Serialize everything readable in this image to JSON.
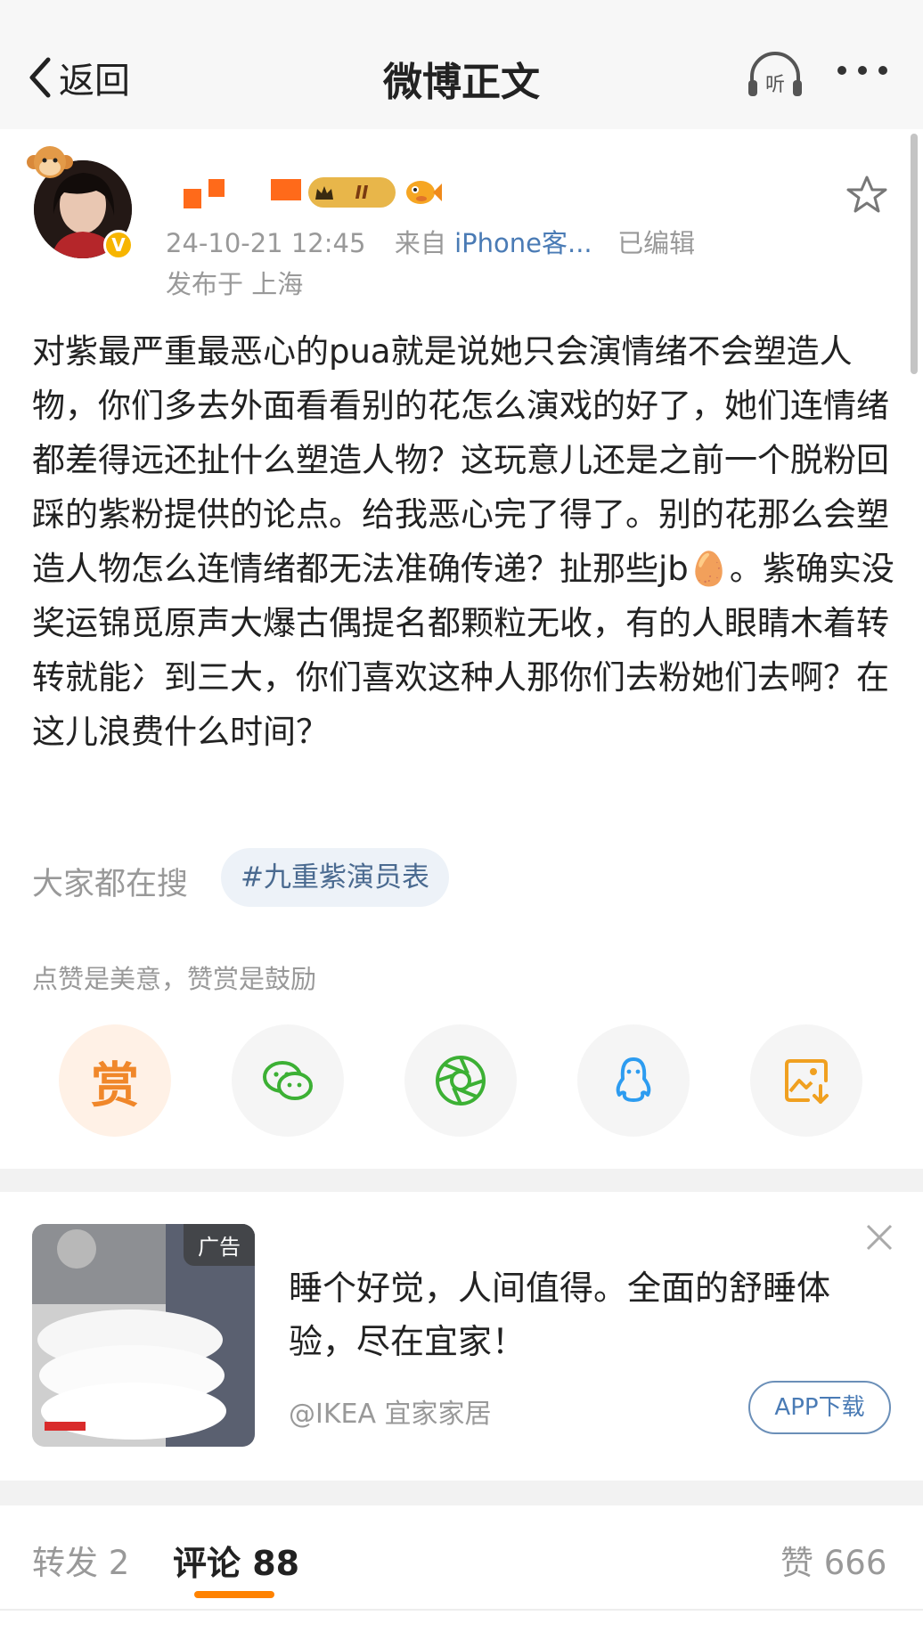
{
  "nav": {
    "back_label": "返回",
    "title": "微博正文",
    "listen_label": "听"
  },
  "author": {
    "verified_mark": "V",
    "level_badge": "II",
    "time": "24-10-21 12:45",
    "source_prefix": "来自",
    "source": "iPhone客...",
    "edited": "已编辑",
    "location": "发布于 上海"
  },
  "post": {
    "text": "对紫最严重最恶心的pua就是说她只会演情绪不会塑造人物，你们多去外面看看别的花怎么演戏的好了，她们连情绪都差得远还扯什么塑造人物？这玩意儿还是之前一个脱粉回踩的紫粉提供的论点。给我恶心完了得了。别的花那么会塑造人物怎么连情绪都无法准确传递？扯那些jb🥚。紫确实没奖运锦觅原声大爆古偶提名都颗粒无收，有的人眼睛木着转转就能冫到三大，你们喜欢这种人那你们去粉她们去啊？在这儿浪费什么时间？"
  },
  "trending": {
    "label": "大家都在搜",
    "tag": "#九重紫演员表"
  },
  "praise": {
    "hint": "点赞是美意，赞赏是鼓励",
    "reward_label": "赏"
  },
  "ad": {
    "tag": "广告",
    "title": "睡个好觉，人间值得。全面的舒睡体验，尽在宜家！",
    "source": "@IKEA 宜家家居",
    "button": "APP下载"
  },
  "tabs": {
    "repost": "转发 2",
    "comment": "评论 88",
    "like": "赞 666"
  },
  "colors": {
    "accent": "#ff8200",
    "link": "#4a7bb5",
    "muted": "#999999"
  }
}
